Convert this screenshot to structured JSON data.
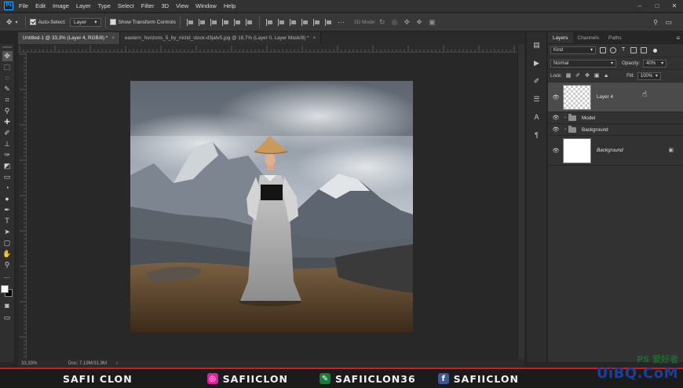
{
  "app": {
    "logo": "Ps"
  },
  "menu": [
    "File",
    "Edit",
    "Image",
    "Layer",
    "Type",
    "Select",
    "Filter",
    "3D",
    "View",
    "Window",
    "Help"
  ],
  "window_controls": [
    "–",
    "□",
    "✕"
  ],
  "options_bar": {
    "auto_select_label": "Auto-Select:",
    "auto_select_checked": true,
    "auto_select_target": "Layer",
    "transform_controls_label": "Show Transform Controls",
    "transform_controls_checked": false,
    "mode_3d_label": "3D Mode:"
  },
  "tabs": [
    {
      "label": "Untitled-1 @ 33,3% (Layer 4, RGB/8) *",
      "active": true
    },
    {
      "label": "eastern_horizons_5_by_mizid_stock-d3jatv5.jpg @ 16,7% (Layer 0, Layer Mask/8) *",
      "active": false
    }
  ],
  "tab_close": "×",
  "tools": [
    {
      "name": "move-tool-icon",
      "glyph": "✥"
    },
    {
      "name": "marquee-tool-icon",
      "glyph": "⬚"
    },
    {
      "name": "lasso-tool-icon",
      "glyph": "◌"
    },
    {
      "name": "quick-select-tool-icon",
      "glyph": "✎"
    },
    {
      "name": "crop-tool-icon",
      "glyph": "⌗"
    },
    {
      "name": "eyedropper-tool-icon",
      "glyph": "⚲"
    },
    {
      "name": "healing-brush-tool-icon",
      "glyph": "✚"
    },
    {
      "name": "brush-tool-icon",
      "glyph": "✐"
    },
    {
      "name": "clone-stamp-tool-icon",
      "glyph": "⊥"
    },
    {
      "name": "history-brush-tool-icon",
      "glyph": "✑"
    },
    {
      "name": "eraser-tool-icon",
      "glyph": "◩"
    },
    {
      "name": "gradient-tool-icon",
      "glyph": "▭"
    },
    {
      "name": "blur-tool-icon",
      "glyph": "◔"
    },
    {
      "name": "dodge-tool-icon",
      "glyph": "●"
    },
    {
      "name": "pen-tool-icon",
      "glyph": "✒"
    },
    {
      "name": "type-tool-icon",
      "glyph": "T"
    },
    {
      "name": "path-select-tool-icon",
      "glyph": "➤"
    },
    {
      "name": "rectangle-tool-icon",
      "glyph": "▢"
    },
    {
      "name": "hand-tool-icon",
      "glyph": "✋"
    },
    {
      "name": "zoom-tool-icon",
      "glyph": "⚲"
    },
    {
      "name": "extra-tools-icon",
      "glyph": "…"
    }
  ],
  "status": {
    "zoom": "33,33%",
    "doc": "Doc: 7,19M/31,9M",
    "arrow": "›"
  },
  "panel_strip_icons": [
    {
      "name": "history-panel-icon",
      "glyph": "▤"
    },
    {
      "name": "actions-panel-icon",
      "glyph": "▶"
    },
    {
      "name": "brush-panel-icon",
      "glyph": "✐"
    },
    {
      "name": "brush-settings-panel-icon",
      "glyph": "☰"
    },
    {
      "name": "character-panel-icon",
      "glyph": "A"
    },
    {
      "name": "paragraph-panel-icon",
      "glyph": "¶"
    }
  ],
  "layers_panel": {
    "tabs": [
      "Layers",
      "Channels",
      "Paths"
    ],
    "active_tab": "Layers",
    "menu_glyph": "≡",
    "filter_kind": "Kind",
    "blend_mode": "Normal",
    "opacity_label": "Opacity:",
    "opacity_value": "40%",
    "lock_label": "Lock:",
    "fill_label": "Fill:",
    "fill_value": "100%",
    "layers": [
      {
        "name": "Layer 4",
        "type": "layer",
        "selected": true,
        "italic": false
      },
      {
        "name": "Model",
        "type": "group",
        "selected": false,
        "italic": false
      },
      {
        "name": "Background",
        "type": "group",
        "selected": false,
        "italic": false
      },
      {
        "name": "Background",
        "type": "background",
        "selected": false,
        "italic": true
      }
    ]
  },
  "banner": {
    "name": "SAFII CLON",
    "instagram": "SAFIICLON",
    "vn": "SAFIICLON36",
    "facebook": "SAFIICLON",
    "watermark_top": "PS 爱好者",
    "watermark_bottom": "UiBQ.CoM",
    "accent": "#c81e24"
  }
}
